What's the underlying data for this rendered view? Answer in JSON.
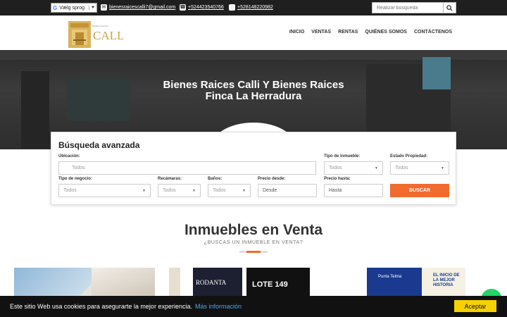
{
  "topbar": {
    "language_label": "Vælg sprog",
    "email": "bienesraicescalli7@gmail.com",
    "phone1": "+524423540766",
    "phone2": "+528148220982",
    "search_placeholder": "Realizar búsqueda"
  },
  "brand": {
    "name": "CALLI",
    "tagline": "BIENES RAICES"
  },
  "nav": [
    "INICIO",
    "VENTAS",
    "RENTAS",
    "QUIÉNES SOMOS",
    "CONTÁCTENOS"
  ],
  "hero": {
    "title": "Bienes Raices Calli Y Bienes Raices Finca La Herradura"
  },
  "search_panel": {
    "title": "Búsqueda avanzada",
    "ubicacion_label": "Ubicación:",
    "ubicacion_placeholder": "Todos",
    "tipo_inmueble_label": "Tipo de inmueble:",
    "tipo_inmueble_value": "Todos",
    "estado_label": "Estado Propiedad:",
    "estado_value": "Todos",
    "tipo_negocio_label": "Tipo de negocio:",
    "tipo_negocio_value": "Todos",
    "recamaras_label": "Recámaras:",
    "recamaras_value": "Todos",
    "banos_label": "Baños:",
    "banos_value": "Todos",
    "precio_desde_label": "Precio desde:",
    "precio_desde_placeholder": "Desde",
    "precio_hasta_label": "Precio hasta:",
    "precio_hasta_placeholder": "Hasta",
    "button": "BUSCAR"
  },
  "section": {
    "title": "Inmuebles en Venta",
    "subtitle": "¿BUSCAS UN INMUEBLE EN VENTA?"
  },
  "cards": [
    {
      "text": ""
    },
    {
      "text": "RODANTA",
      "badge": "LOTE 149"
    },
    {
      "text": "Punta Telma",
      "slogan": "EL INICIO DE LA MEJOR HISTORIA"
    }
  ],
  "cookie": {
    "text": "Este sitio Web usa cookies para asegurarte la mejor experiencia.",
    "link": "Más información",
    "button": "Aceptar"
  },
  "colors": {
    "accent": "#f26b2e",
    "gold": "#c9a24a",
    "cookie_button": "#f5d100"
  }
}
